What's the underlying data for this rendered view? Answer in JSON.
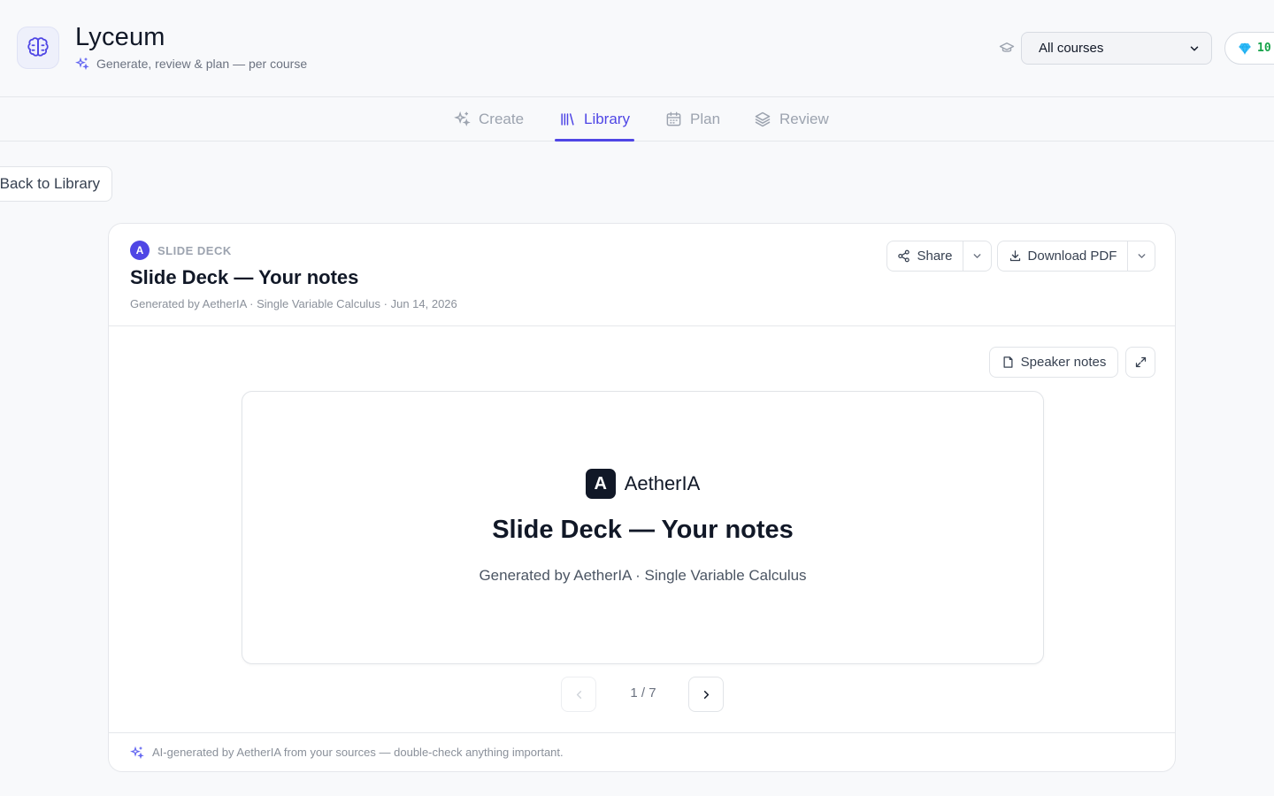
{
  "app": {
    "title": "Lyceum",
    "subtitle": "Generate, review & plan — per course",
    "logo_icon": "brain-icon"
  },
  "header": {
    "course_select": {
      "value": "All courses"
    },
    "credits": {
      "value": "10",
      "icon": "gem-icon"
    }
  },
  "tabs": [
    {
      "label": "Create",
      "icon": "sparkles-icon",
      "active": false
    },
    {
      "label": "Library",
      "icon": "library-icon",
      "active": true
    },
    {
      "label": "Plan",
      "icon": "calendar-icon",
      "active": false
    },
    {
      "label": "Review",
      "icon": "layers-icon",
      "active": false
    }
  ],
  "back_button": {
    "label": "Back to Library"
  },
  "card": {
    "badge_letter": "A",
    "type_label": "SLIDE DECK",
    "title": "Slide Deck — Your notes",
    "meta": "Generated by AetherIA · Single Variable Calculus · Jun 14, 2026",
    "actions": {
      "share_label": "Share",
      "download_label": "Download PDF",
      "speaker_notes_label": "Speaker notes"
    },
    "slide": {
      "brand_letter": "A",
      "brand_name": "AetherIA",
      "title": "Slide Deck — Your notes",
      "subtitle": "Generated by AetherIA · Single Variable Calculus"
    },
    "pager": {
      "text": "1 / 7"
    },
    "footer_note": "AI-generated by AetherIA from your sources — double-check anything important."
  },
  "colors": {
    "accent": "#4f46e5",
    "credits": "#16a34a",
    "text_dark": "#111827",
    "text_muted": "#9ca3af"
  }
}
